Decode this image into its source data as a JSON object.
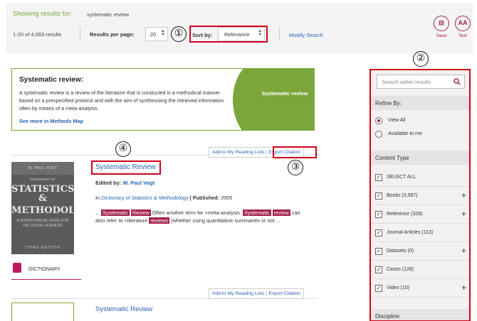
{
  "header": {
    "showing_label": "Showing results for:",
    "query": "systematic review",
    "results_count": "1-20 of 4,063 results",
    "results_per_page_label": "Results per page:",
    "results_per_page_value": "20",
    "sort_label": "Sort by:",
    "sort_value": "Relevance",
    "modify_search": "Modify Search"
  },
  "tools": [
    {
      "label": "Save",
      "glyph": "⊟",
      "icon": "save-icon"
    },
    {
      "label": "Text",
      "glyph": "AA",
      "icon": "text-size-icon"
    }
  ],
  "annotations": [
    "①",
    "②",
    "③",
    "④"
  ],
  "definition": {
    "title": "Systematic review:",
    "body": "A systematic review is a review of the literature that is conducted in a methodical manner based on a prespecified protocol and with the aim of synthesising the retrieved information often by means of a meta-analysis.",
    "link": "See more in Methods Map",
    "badge": "Systematic review"
  },
  "results": [
    {
      "actions": [
        "Add to My Reading Lists",
        "Export Citation"
      ],
      "title": "Systematic Review",
      "edited_by_label": "Edited by:",
      "editor": "W. Paul Vogt",
      "in_label": "In",
      "source": "Dictionary of Statistics & Methodology",
      "published_label": "| Published:",
      "year": "2005",
      "snippet": {
        "pre": "...",
        "hl1": "Systematic",
        "hl2": "Review",
        "mid1": "Often another term for +meta-analysis.",
        "hl3": "Systematic",
        "hl4": "review",
        "mid2": "can also refer to +literature",
        "hl5": "reviews",
        "post": "(whether using quantitative summaries or not ..."
      },
      "cover": {
        "author": "W. PAUL VOGT",
        "small": "DICTIONARY OF",
        "title_lines": [
          "STATISTICS &",
          "METHODOLOGY"
        ],
        "subtitle": "A NONTECHNICAL GUIDE FOR THE SOCIAL SCIENCES",
        "edition": "THIRD EDITION"
      },
      "content_type": "DICTIONARY"
    },
    {
      "actions": [
        "Add to My Reading Lists",
        "Export Citation"
      ],
      "title": "Systematic Review"
    }
  ],
  "sidebar": {
    "search_placeholder": "Search within results",
    "refine_label": "Refine By:",
    "radios": [
      {
        "label": "View All",
        "selected": true
      },
      {
        "label": "Available to me",
        "selected": false
      }
    ],
    "content_type_label": "Content Type",
    "content_types": [
      {
        "label": "SELECT ALL",
        "expandable": false
      },
      {
        "label": "Books (3,597)",
        "expandable": true
      },
      {
        "label": "Reference (328)",
        "expandable": true
      },
      {
        "label": "Journal Articles (113)",
        "expandable": false
      },
      {
        "label": "Datasets (0)",
        "expandable": true
      },
      {
        "label": "Cases (128)",
        "expandable": false
      },
      {
        "label": "Video (10)",
        "expandable": true
      }
    ],
    "discipline_label": "Discipline",
    "check_glyph": "✓",
    "plus_glyph": "+"
  },
  "colors": {
    "brand_green": "#7aa63a",
    "highlight": "#a3214b",
    "link": "#2a62b5",
    "annotation_red": "#d0021b"
  }
}
